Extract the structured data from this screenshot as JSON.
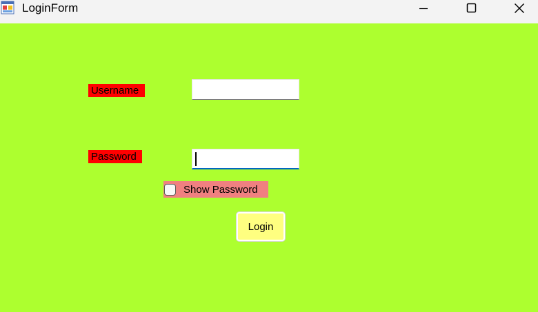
{
  "window": {
    "title": "LoginForm",
    "icon": "form-app-icon",
    "controls": [
      "minimize-icon",
      "maximize-icon",
      "close-icon"
    ]
  },
  "form": {
    "background": "#adff2f",
    "username_label": "Username",
    "username_value": "",
    "password_label": "Password",
    "password_value": "",
    "show_password": {
      "label": "Show Password",
      "checked": false
    },
    "login_button": "Login"
  },
  "colors": {
    "label_background": "#ff0000",
    "checkbox_background": "#f08080",
    "button_background": "#ffff80",
    "focus_underline": "#0067c0"
  }
}
